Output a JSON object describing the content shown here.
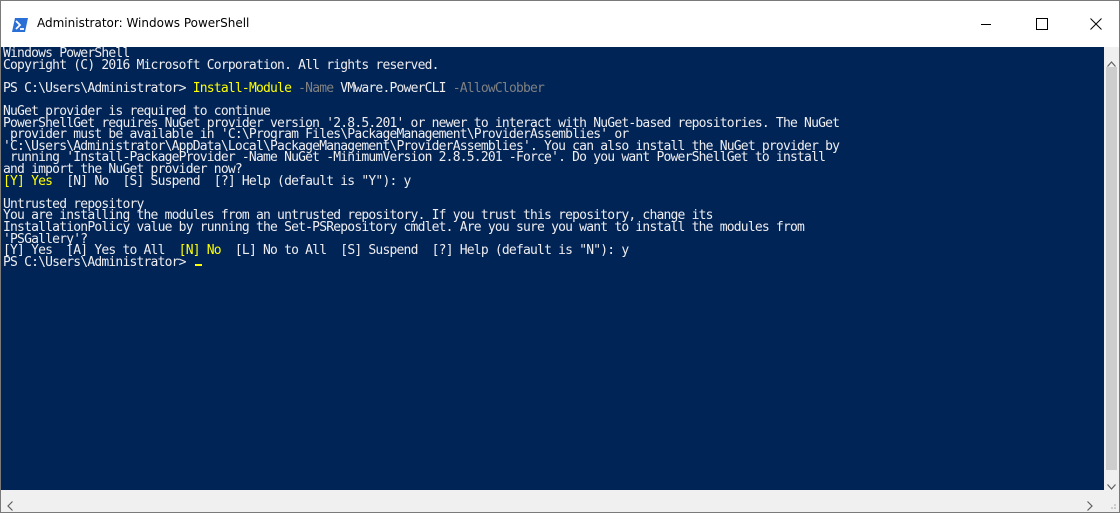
{
  "window": {
    "title": "Administrator: Windows PowerShell",
    "icon": "powershell-icon",
    "controls": [
      "minimize-icon",
      "maximize-icon",
      "close-icon"
    ]
  },
  "console": {
    "background": "#012456",
    "lines": [
      {
        "segments": [
          {
            "text": "Windows PowerShell",
            "style": "normal"
          }
        ]
      },
      {
        "segments": [
          {
            "text": "Copyright (C) 2016 Microsoft Corporation. All rights reserved.",
            "style": "normal"
          }
        ]
      },
      {
        "segments": [
          {
            "text": "",
            "style": "normal"
          }
        ]
      },
      {
        "segments": [
          {
            "text": "PS C:\\Users\\Administrator> ",
            "style": "normal"
          },
          {
            "text": "Install-Module",
            "style": "cmd"
          },
          {
            "text": " -Name ",
            "style": "param"
          },
          {
            "text": "VMware.PowerCLI",
            "style": "arg"
          },
          {
            "text": " -AllowClobber",
            "style": "param"
          }
        ]
      },
      {
        "segments": [
          {
            "text": "",
            "style": "normal"
          }
        ]
      },
      {
        "segments": [
          {
            "text": "NuGet provider is required to continue",
            "style": "normal"
          }
        ]
      },
      {
        "segments": [
          {
            "text": "PowerShellGet requires NuGet provider version '2.8.5.201' or newer to interact with NuGet-based repositories. The NuGet",
            "style": "normal"
          }
        ]
      },
      {
        "segments": [
          {
            "text": " provider must be available in 'C:\\Program Files\\PackageManagement\\ProviderAssemblies' or",
            "style": "normal"
          }
        ]
      },
      {
        "segments": [
          {
            "text": "'C:\\Users\\Administrator\\AppData\\Local\\PackageManagement\\ProviderAssemblies'. You can also install the NuGet provider by",
            "style": "normal"
          }
        ]
      },
      {
        "segments": [
          {
            "text": " running 'Install-PackageProvider -Name NuGet -MinimumVersion 2.8.5.201 -Force'. Do you want PowerShellGet to install",
            "style": "normal"
          }
        ]
      },
      {
        "segments": [
          {
            "text": "and import the NuGet provider now?",
            "style": "normal"
          }
        ]
      },
      {
        "segments": [
          {
            "text": "[Y] Yes",
            "style": "yellow"
          },
          {
            "text": "  [N] No  [S] Suspend  [?] Help (default is \"Y\"): y",
            "style": "normal"
          }
        ]
      },
      {
        "segments": [
          {
            "text": "",
            "style": "normal"
          }
        ]
      },
      {
        "segments": [
          {
            "text": "Untrusted repository",
            "style": "normal"
          }
        ]
      },
      {
        "segments": [
          {
            "text": "You are installing the modules from an untrusted repository. If you trust this repository, change its",
            "style": "normal"
          }
        ]
      },
      {
        "segments": [
          {
            "text": "InstallationPolicy value by running the Set-PSRepository cmdlet. Are you sure you want to install the modules from",
            "style": "normal"
          }
        ]
      },
      {
        "segments": [
          {
            "text": "'PSGallery'?",
            "style": "normal"
          }
        ]
      },
      {
        "segments": [
          {
            "text": "[Y] Yes  [A] Yes to All  ",
            "style": "normal"
          },
          {
            "text": "[N] No",
            "style": "yellow"
          },
          {
            "text": "  [L] No to All  [S] Suspend  [?] Help (default is \"N\"): y",
            "style": "normal"
          }
        ]
      },
      {
        "segments": [
          {
            "text": "PS C:\\Users\\Administrator> ",
            "style": "normal"
          }
        ],
        "cursor": true
      }
    ]
  }
}
